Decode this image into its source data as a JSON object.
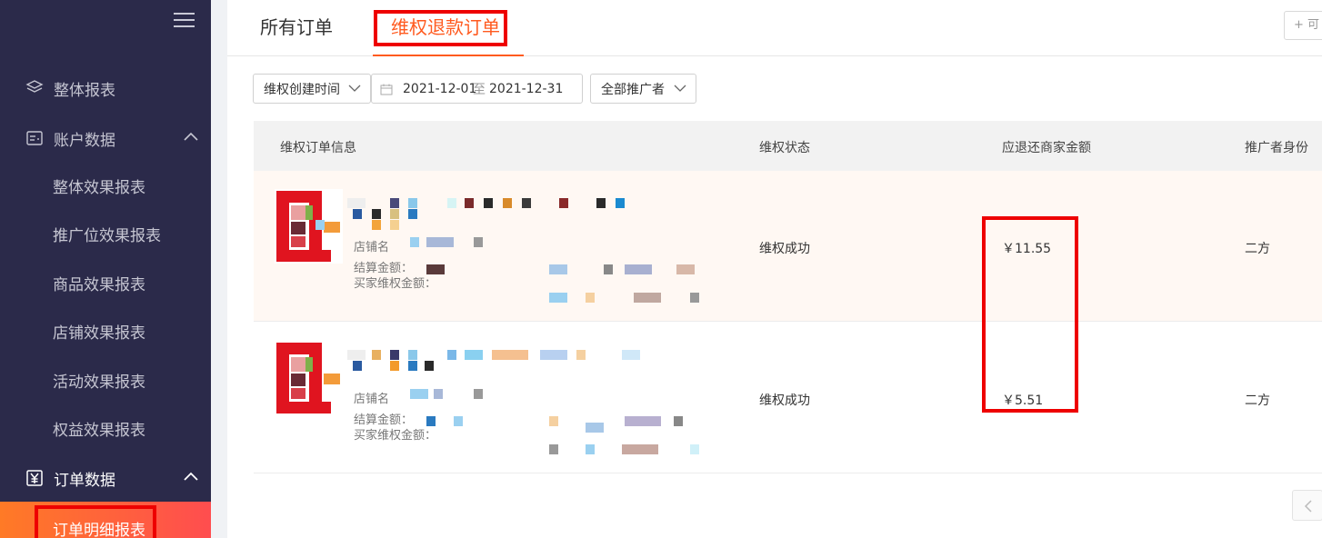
{
  "sidebar": {
    "nav": [
      {
        "label": "整体报表"
      },
      {
        "label": "账户数据"
      },
      {
        "label": "订单数据"
      }
    ],
    "account_sub": [
      {
        "label": "整体效果报表"
      },
      {
        "label": "推广位效果报表"
      },
      {
        "label": "商品效果报表"
      },
      {
        "label": "店铺效果报表"
      },
      {
        "label": "活动效果报表"
      },
      {
        "label": "权益效果报表"
      }
    ],
    "order_sub": [
      {
        "label": "订单明细报表"
      }
    ]
  },
  "tabs": [
    {
      "label": "所有订单"
    },
    {
      "label": "维权退款订单"
    }
  ],
  "add_button_label": "+ 可",
  "filters": {
    "time_type": "维权创建时间",
    "date_start": "2021-12-01",
    "date_sep": "至",
    "date_end": "2021-12-31",
    "promoter": "全部推广者"
  },
  "table": {
    "headers": [
      "维权订单信息",
      "维权状态",
      "应退还商家金额",
      "推广者身份"
    ],
    "field_labels": {
      "shop": "店铺名",
      "settle": "结算金额：",
      "buyer": "买家维权金额："
    },
    "rows": [
      {
        "status": "维权成功",
        "amount": "￥11.55",
        "identity": "二方"
      },
      {
        "status": "维权成功",
        "amount": "￥5.51",
        "identity": "二方"
      }
    ]
  },
  "colors": {
    "sidebar_bg": "#2b2a4a",
    "accent": "#ff5a1f",
    "annotation": "#ee0000"
  }
}
